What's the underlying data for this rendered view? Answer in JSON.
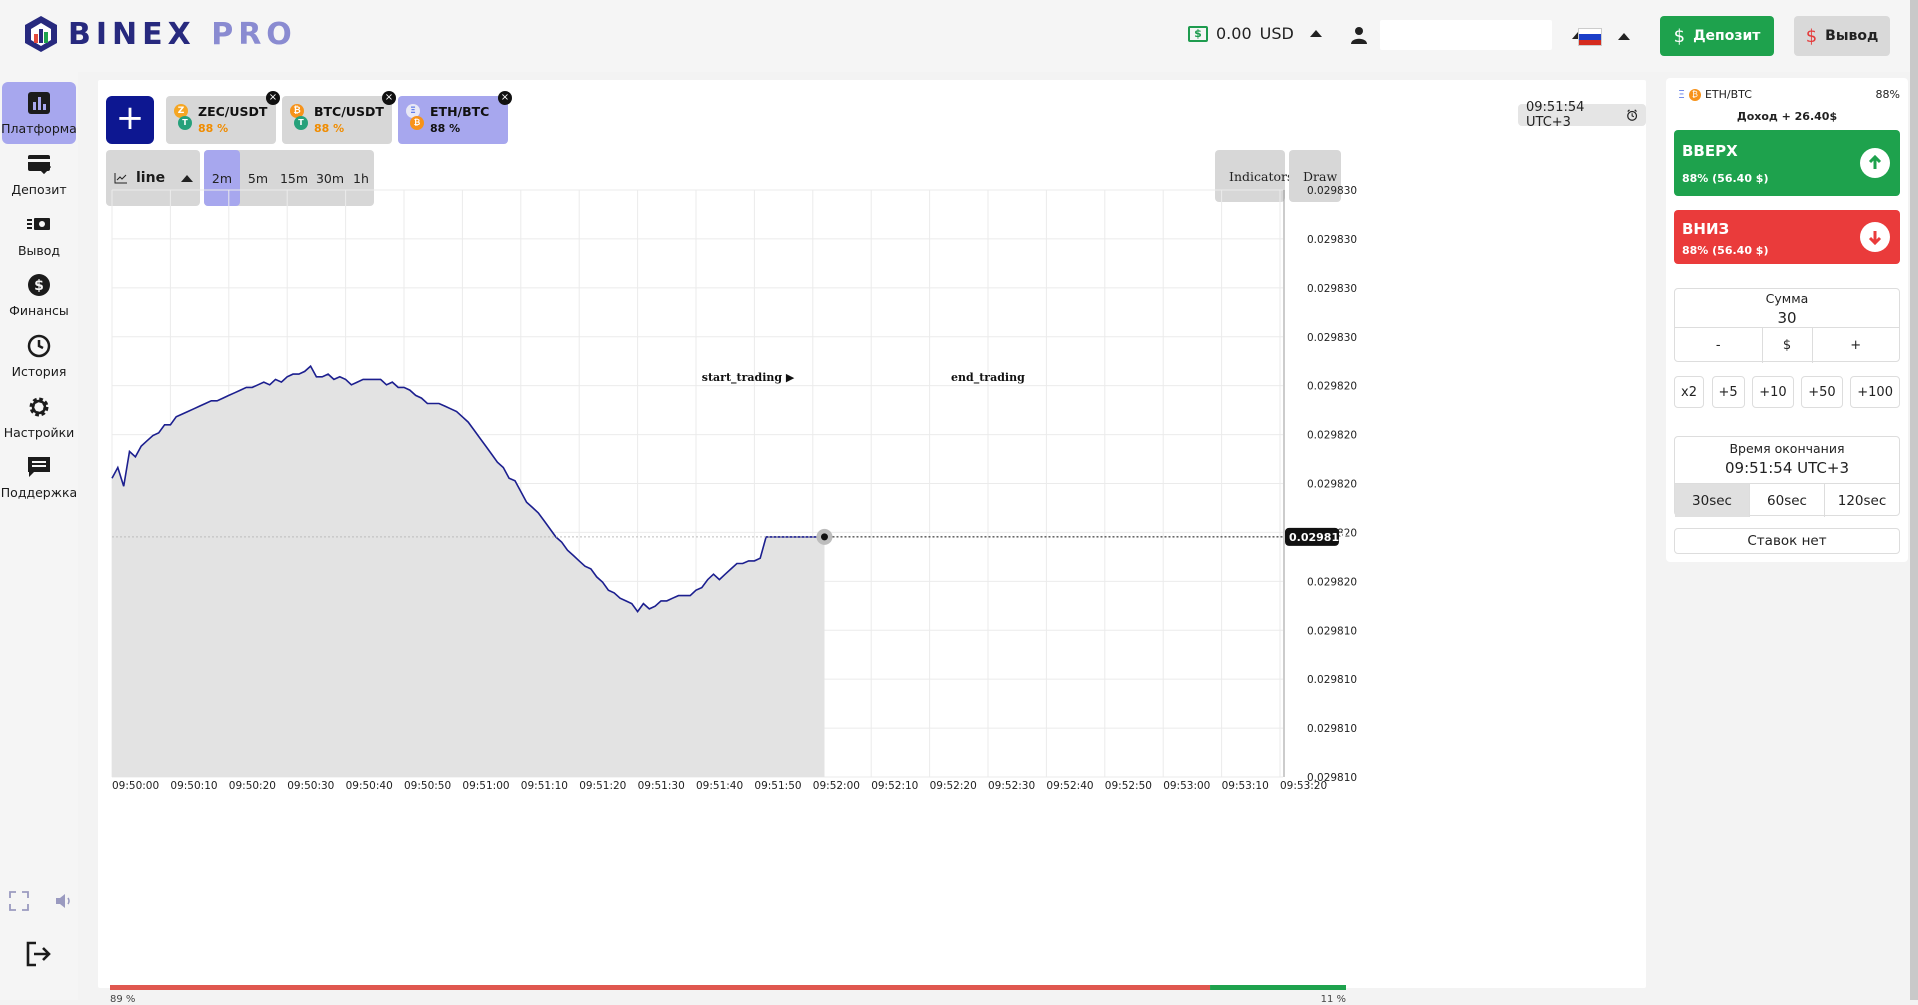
{
  "header": {
    "logo_text_main": "BINEX",
    "logo_text_accent": "PRO",
    "balance_amount": "0.00",
    "balance_currency": "USD",
    "deposit_label": "Депозит",
    "withdraw_label": "Вывод",
    "currency_icon": "dollar-icon"
  },
  "sidebar": {
    "items": [
      {
        "label": "Платформа",
        "icon": "bar-chart-icon",
        "active": true
      },
      {
        "label": "Депозит",
        "icon": "card-icon",
        "active": false
      },
      {
        "label": "Вывод",
        "icon": "cash-icon",
        "active": false
      },
      {
        "label": "Финансы",
        "icon": "dollar-circle-icon",
        "active": false
      },
      {
        "label": "История",
        "icon": "clock-icon",
        "active": false
      },
      {
        "label": "Настройки",
        "icon": "gear-icon",
        "active": false
      },
      {
        "label": "Поддержка",
        "icon": "chat-icon",
        "active": false
      }
    ]
  },
  "asset_tabs": [
    {
      "name": "ZEC/USDT",
      "pct": "88 %",
      "coin": "Z",
      "active": false
    },
    {
      "name": "BTC/USDT",
      "pct": "88 %",
      "coin": "₿",
      "active": false
    },
    {
      "name": "ETH/BTC",
      "pct": "88 %",
      "coin": "Ξ",
      "active": true
    }
  ],
  "clock": "09:51:54 UTC+3",
  "chart_type_label": "line",
  "timeframes": [
    {
      "label": "2m",
      "active": true
    },
    {
      "label": "5m",
      "active": false
    },
    {
      "label": "15m",
      "active": false
    },
    {
      "label": "30m",
      "active": false
    },
    {
      "label": "1h",
      "active": false
    }
  ],
  "tools": {
    "indicators": "Indicators",
    "draw": "Draw"
  },
  "chart_data": {
    "type": "area",
    "title": "",
    "xlabel": "",
    "ylabel": "",
    "x_ticks": [
      "09:50:00",
      "09:50:10",
      "09:50:20",
      "09:50:30",
      "09:50:40",
      "09:50:50",
      "09:51:00",
      "09:51:10",
      "09:51:20",
      "09:51:30",
      "09:51:40",
      "09:51:50",
      "09:52:00",
      "09:52:10",
      "09:52:20",
      "09:52:30",
      "09:52:40",
      "09:52:50",
      "09:53:00",
      "09:53:10",
      "09:53:20"
    ],
    "y_tick_labels": [
      "0.029830",
      "0.029830",
      "0.029830",
      "0.029830",
      "0.029820",
      "0.029820",
      "0.029820",
      "0.029820",
      "0.029820",
      "0.029810",
      "0.029810",
      "0.029810",
      "0.029810"
    ],
    "ylim": [
      0.029809,
      0.029831
    ],
    "current_price_label": "0.029818",
    "markers": [
      {
        "label": "start_trading ▶",
        "x_sec": 114
      },
      {
        "label": "end_trading",
        "x_sec": 156
      }
    ],
    "series": [
      {
        "x_sec": [
          0,
          1,
          2,
          3,
          4,
          5,
          6,
          7,
          8,
          9,
          10,
          11,
          12,
          13,
          14,
          15,
          16,
          17,
          18,
          19,
          20,
          21,
          22,
          23,
          24,
          25,
          26,
          27,
          28,
          29,
          30,
          31,
          32,
          33,
          34,
          35,
          36,
          37,
          38,
          39,
          40,
          41,
          42,
          43,
          44,
          45,
          46,
          47,
          48,
          49,
          50,
          51,
          52,
          53,
          54,
          55,
          56,
          57,
          58,
          59,
          60,
          61,
          62,
          63,
          64,
          65,
          66,
          67,
          68,
          69,
          70,
          71,
          72,
          73,
          74,
          75,
          76,
          77,
          78,
          79,
          80,
          81,
          82,
          83,
          84,
          85,
          86,
          87,
          88,
          89,
          90,
          91,
          92,
          93,
          94,
          95,
          96,
          97,
          98,
          99,
          100,
          101,
          102,
          103,
          104,
          105,
          106,
          107,
          108,
          109,
          110,
          111,
          112,
          113,
          114,
          115,
          116,
          117,
          118,
          119,
          120,
          121,
          122
        ],
        "values": [
          0.0298202,
          0.0298206,
          0.0298199,
          0.0298212,
          0.029821,
          0.0298214,
          0.0298216,
          0.0298218,
          0.0298219,
          0.0298222,
          0.0298222,
          0.0298225,
          0.0298226,
          0.0298227,
          0.0298228,
          0.0298229,
          0.029823,
          0.0298231,
          0.0298231,
          0.0298232,
          0.0298233,
          0.0298234,
          0.0298235,
          0.0298236,
          0.0298236,
          0.0298237,
          0.0298238,
          0.0298237,
          0.0298239,
          0.0298238,
          0.029824,
          0.0298241,
          0.0298241,
          0.0298242,
          0.0298244,
          0.029824,
          0.029824,
          0.0298241,
          0.0298239,
          0.029824,
          0.0298239,
          0.0298237,
          0.0298238,
          0.0298239,
          0.0298239,
          0.0298239,
          0.0298239,
          0.0298237,
          0.0298238,
          0.0298236,
          0.0298236,
          0.0298235,
          0.0298233,
          0.0298232,
          0.029823,
          0.029823,
          0.029823,
          0.0298229,
          0.0298228,
          0.0298227,
          0.0298225,
          0.0298223,
          0.029822,
          0.0298217,
          0.0298214,
          0.0298211,
          0.0298208,
          0.0298206,
          0.0298202,
          0.0298201,
          0.0298197,
          0.0298193,
          0.0298191,
          0.0298189,
          0.0298186,
          0.0298183,
          0.029818,
          0.0298178,
          0.0298175,
          0.0298173,
          0.0298171,
          0.0298169,
          0.0298168,
          0.0298165,
          0.0298163,
          0.029816,
          0.0298159,
          0.0298157,
          0.0298156,
          0.0298155,
          0.0298152,
          0.0298155,
          0.0298153,
          0.0298154,
          0.0298156,
          0.0298156,
          0.0298157,
          0.0298158,
          0.0298158,
          0.0298158,
          0.029816,
          0.0298161,
          0.0298164,
          0.0298166,
          0.0298164,
          0.0298166,
          0.0298168,
          0.029817,
          0.029817,
          0.0298171,
          0.0298171,
          0.0298172,
          0.029818,
          0.029818,
          0.029818,
          0.029818,
          0.029818,
          0.029818,
          0.029818,
          0.029818,
          0.029818,
          0.029818,
          0.029818
        ]
      }
    ]
  },
  "progress": {
    "up_pct": 89,
    "down_pct": 11,
    "up_label": "89 %",
    "down_label": "11 %",
    "up_color": "#e0574f",
    "down_color": "#1ea24d"
  },
  "panel": {
    "pair": "ETH/BTC",
    "pct": "88%",
    "income": "Доход + 26.40$",
    "up_label": "ВВЕРХ",
    "up_sub": "88% (56.40 $)",
    "down_label": "ВНИЗ",
    "down_sub": "88% (56.40 $)",
    "sum_label": "Сумма",
    "sum_value": "30",
    "minus": "-",
    "dollar": "$",
    "plus": "+",
    "quick": [
      "x2",
      "+5",
      "+10",
      "+50",
      "+100"
    ],
    "exp_label": "Время окончания",
    "exp_time": "09:51:54 UTC+3",
    "exp_options": [
      {
        "label": "30sec",
        "active": true
      },
      {
        "label": "60sec",
        "active": false
      },
      {
        "label": "120sec",
        "active": false
      }
    ],
    "no_bets": "Ставок нет",
    "up_color": "#1ea24d",
    "down_color": "#ea3b3b"
  }
}
